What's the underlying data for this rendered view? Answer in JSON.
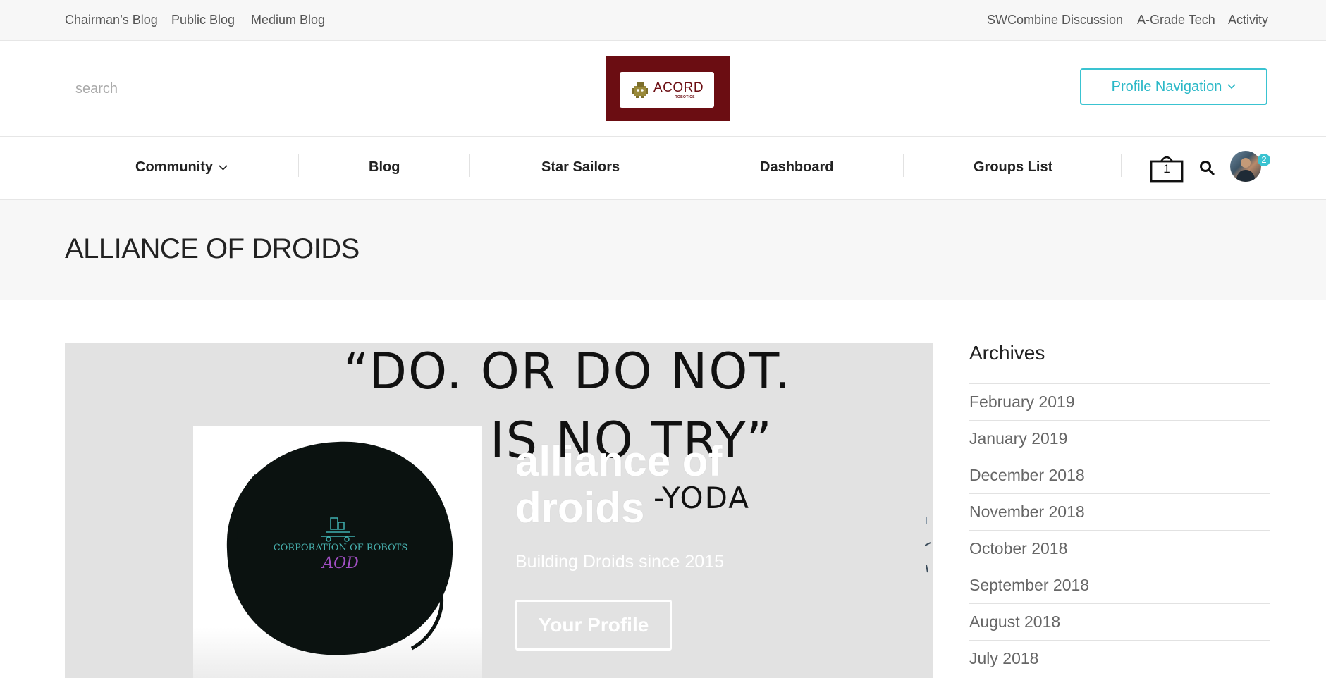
{
  "topbar": {
    "left_links": [
      "Chairman’s Blog",
      "Public Blog",
      "Medium Blog"
    ],
    "right_links": [
      "SWCombine Discussion",
      "A-Grade Tech",
      "Activity"
    ]
  },
  "header": {
    "search_placeholder": "search",
    "logo": {
      "name": "ACORD",
      "sub": "ROBOTICS",
      "bg_color": "#6b0d12"
    },
    "profile_nav_label": "Profile Navigation",
    "accent_color": "#3ac3d1"
  },
  "nav": {
    "items": [
      "Community",
      "Blog",
      "Star Sailors",
      "Dashboard",
      "Groups List"
    ],
    "cart_count": "1",
    "notification_count": "2",
    "icons": [
      "chevron-down-icon",
      "cart-icon",
      "search-icon",
      "avatar"
    ]
  },
  "page": {
    "title": "ALLIANCE OF DROIDS"
  },
  "hero": {
    "quote_lines": [
      "“DO. OR DO NOT.",
      "IS NO TRY”",
      "-YODA"
    ],
    "avatar_text_line1": "CORPORATION OF ROBOTS",
    "avatar_text_line2": "AOD",
    "group_name": "alliance of droids",
    "tagline": "Building Droids since 2015",
    "profile_button": "Your Profile"
  },
  "sidebar": {
    "archives_title": "Archives",
    "archives": [
      "February 2019",
      "January 2019",
      "December 2018",
      "November 2018",
      "October 2018",
      "September 2018",
      "August 2018",
      "July 2018"
    ]
  }
}
